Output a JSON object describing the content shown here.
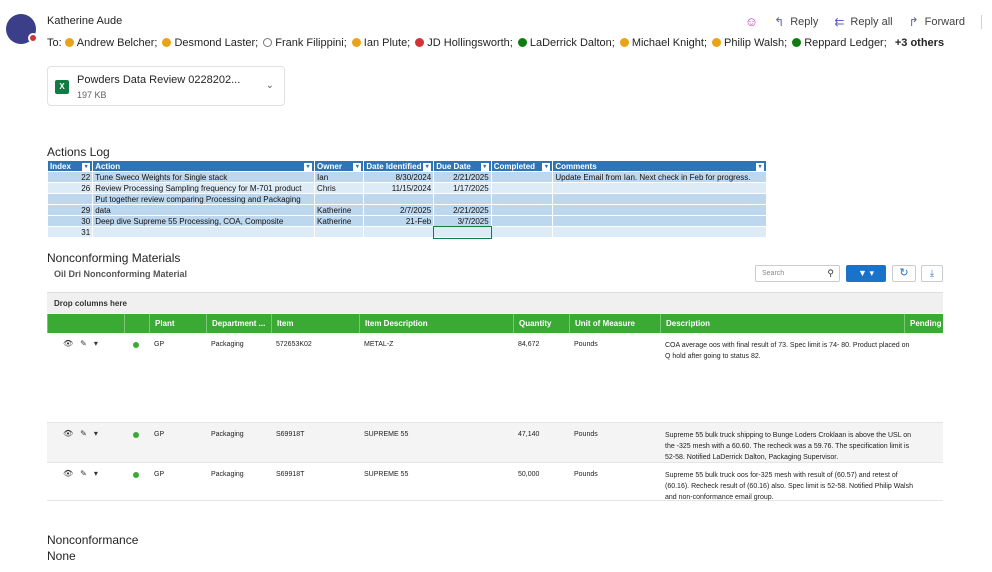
{
  "email": {
    "sender": "Katherine Aude",
    "to_label": "To:",
    "recipients": [
      {
        "name": "Andrew Belcher;",
        "status": "away"
      },
      {
        "name": "Desmond Laster;",
        "status": "away"
      },
      {
        "name": "Frank Filippini;",
        "status": "off"
      },
      {
        "name": "Ian Plute;",
        "status": "away"
      },
      {
        "name": "JD Hollingsworth;",
        "status": "busy"
      },
      {
        "name": "LaDerrick Dalton;",
        "status": "avail"
      },
      {
        "name": "Michael Knight;",
        "status": "away"
      },
      {
        "name": "Philip Walsh;",
        "status": "away"
      },
      {
        "name": "Reppard Ledger;",
        "status": "avail"
      }
    ],
    "more_label": "+3 others",
    "actions": {
      "reply": "Reply",
      "reply_all": "Reply all",
      "forward": "Forward"
    }
  },
  "attachment": {
    "name": "Powders Data Review 0228202...",
    "size": "197 KB",
    "icon": "excel-icon"
  },
  "actions_log": {
    "title": "Actions Log",
    "headers": [
      "Index",
      "Action",
      "Owner",
      "Date Identified",
      "Due Date",
      "Completed",
      "Comments"
    ],
    "rows": [
      {
        "index": "22",
        "action": "Tune Sweco Weights for Single stack",
        "owner": "Ian",
        "identified": "8/30/2024",
        "due": "2/21/2025",
        "completed": "",
        "comments": "Update Email from Ian.  Next check in Feb for progress."
      },
      {
        "index": "26",
        "action": "Review Processing Sampling frequency for M-701 product",
        "owner": "Chris",
        "identified": "11/15/2024",
        "due": "1/17/2025",
        "completed": "",
        "comments": ""
      },
      {
        "index": "",
        "action": "Put together review comparing Processing and Packaging",
        "owner": "",
        "identified": "",
        "due": "",
        "completed": "",
        "comments": ""
      },
      {
        "index": "29",
        "action": "data",
        "owner": "Katherine",
        "identified": "2/7/2025",
        "due": "2/21/2025",
        "completed": "",
        "comments": ""
      },
      {
        "index": "30",
        "action": "Deep dive Supreme 55 Processing, COA, Composite",
        "owner": "Katherine",
        "identified": "21-Feb",
        "due": "3/7/2025",
        "completed": "",
        "comments": ""
      },
      {
        "index": "31",
        "action": "",
        "owner": "",
        "identified": "",
        "due": "",
        "completed": "",
        "comments": ""
      }
    ]
  },
  "nonconforming": {
    "section_title": "Nonconforming Materials",
    "grid_title": "Oil Dri Nonconforming Material",
    "search_placeholder": "Search",
    "drop_label": "Drop columns here",
    "columns": [
      "Plant",
      "Department ...",
      "Item",
      "Item Description",
      "Quantity",
      "Unit of Measure",
      "Description",
      "Pending"
    ],
    "rows": [
      {
        "plant": "GP",
        "department": "Packaging",
        "item": "572653K02",
        "item_description": "METAL-Z",
        "quantity": "84,672",
        "uom": "Pounds",
        "description": "COA average oos with final result of 73. Spec limit is 74- 80. Product placed on Q hold after going to status 82."
      },
      {
        "plant": "GP",
        "department": "Packaging",
        "item": "S69918T",
        "item_description": "SUPREME 55",
        "quantity": "47,140",
        "uom": "Pounds",
        "description": "Supreme 55 bulk truck shipping to Bunge Loders Croklaan is above the USL on the -325 mesh with a 60.60. The recheck was a 59.76. The specification limit is 52-58. Notified LaDerrick Dalton, Packaging Supervisor."
      },
      {
        "plant": "GP",
        "department": "Packaging",
        "item": "S69918T",
        "item_description": "SUPREME 55",
        "quantity": "50,000",
        "uom": "Pounds",
        "description": "Supreme 55 bulk truck oos for-325 mesh with result of (60.57) and retest of (60.16). Recheck result of (60.16) also. Spec limit is 52-58. Notified Philip Walsh and non-conformance email group."
      }
    ]
  },
  "nonconformance": {
    "title": "Nonconformance",
    "value": "None"
  }
}
